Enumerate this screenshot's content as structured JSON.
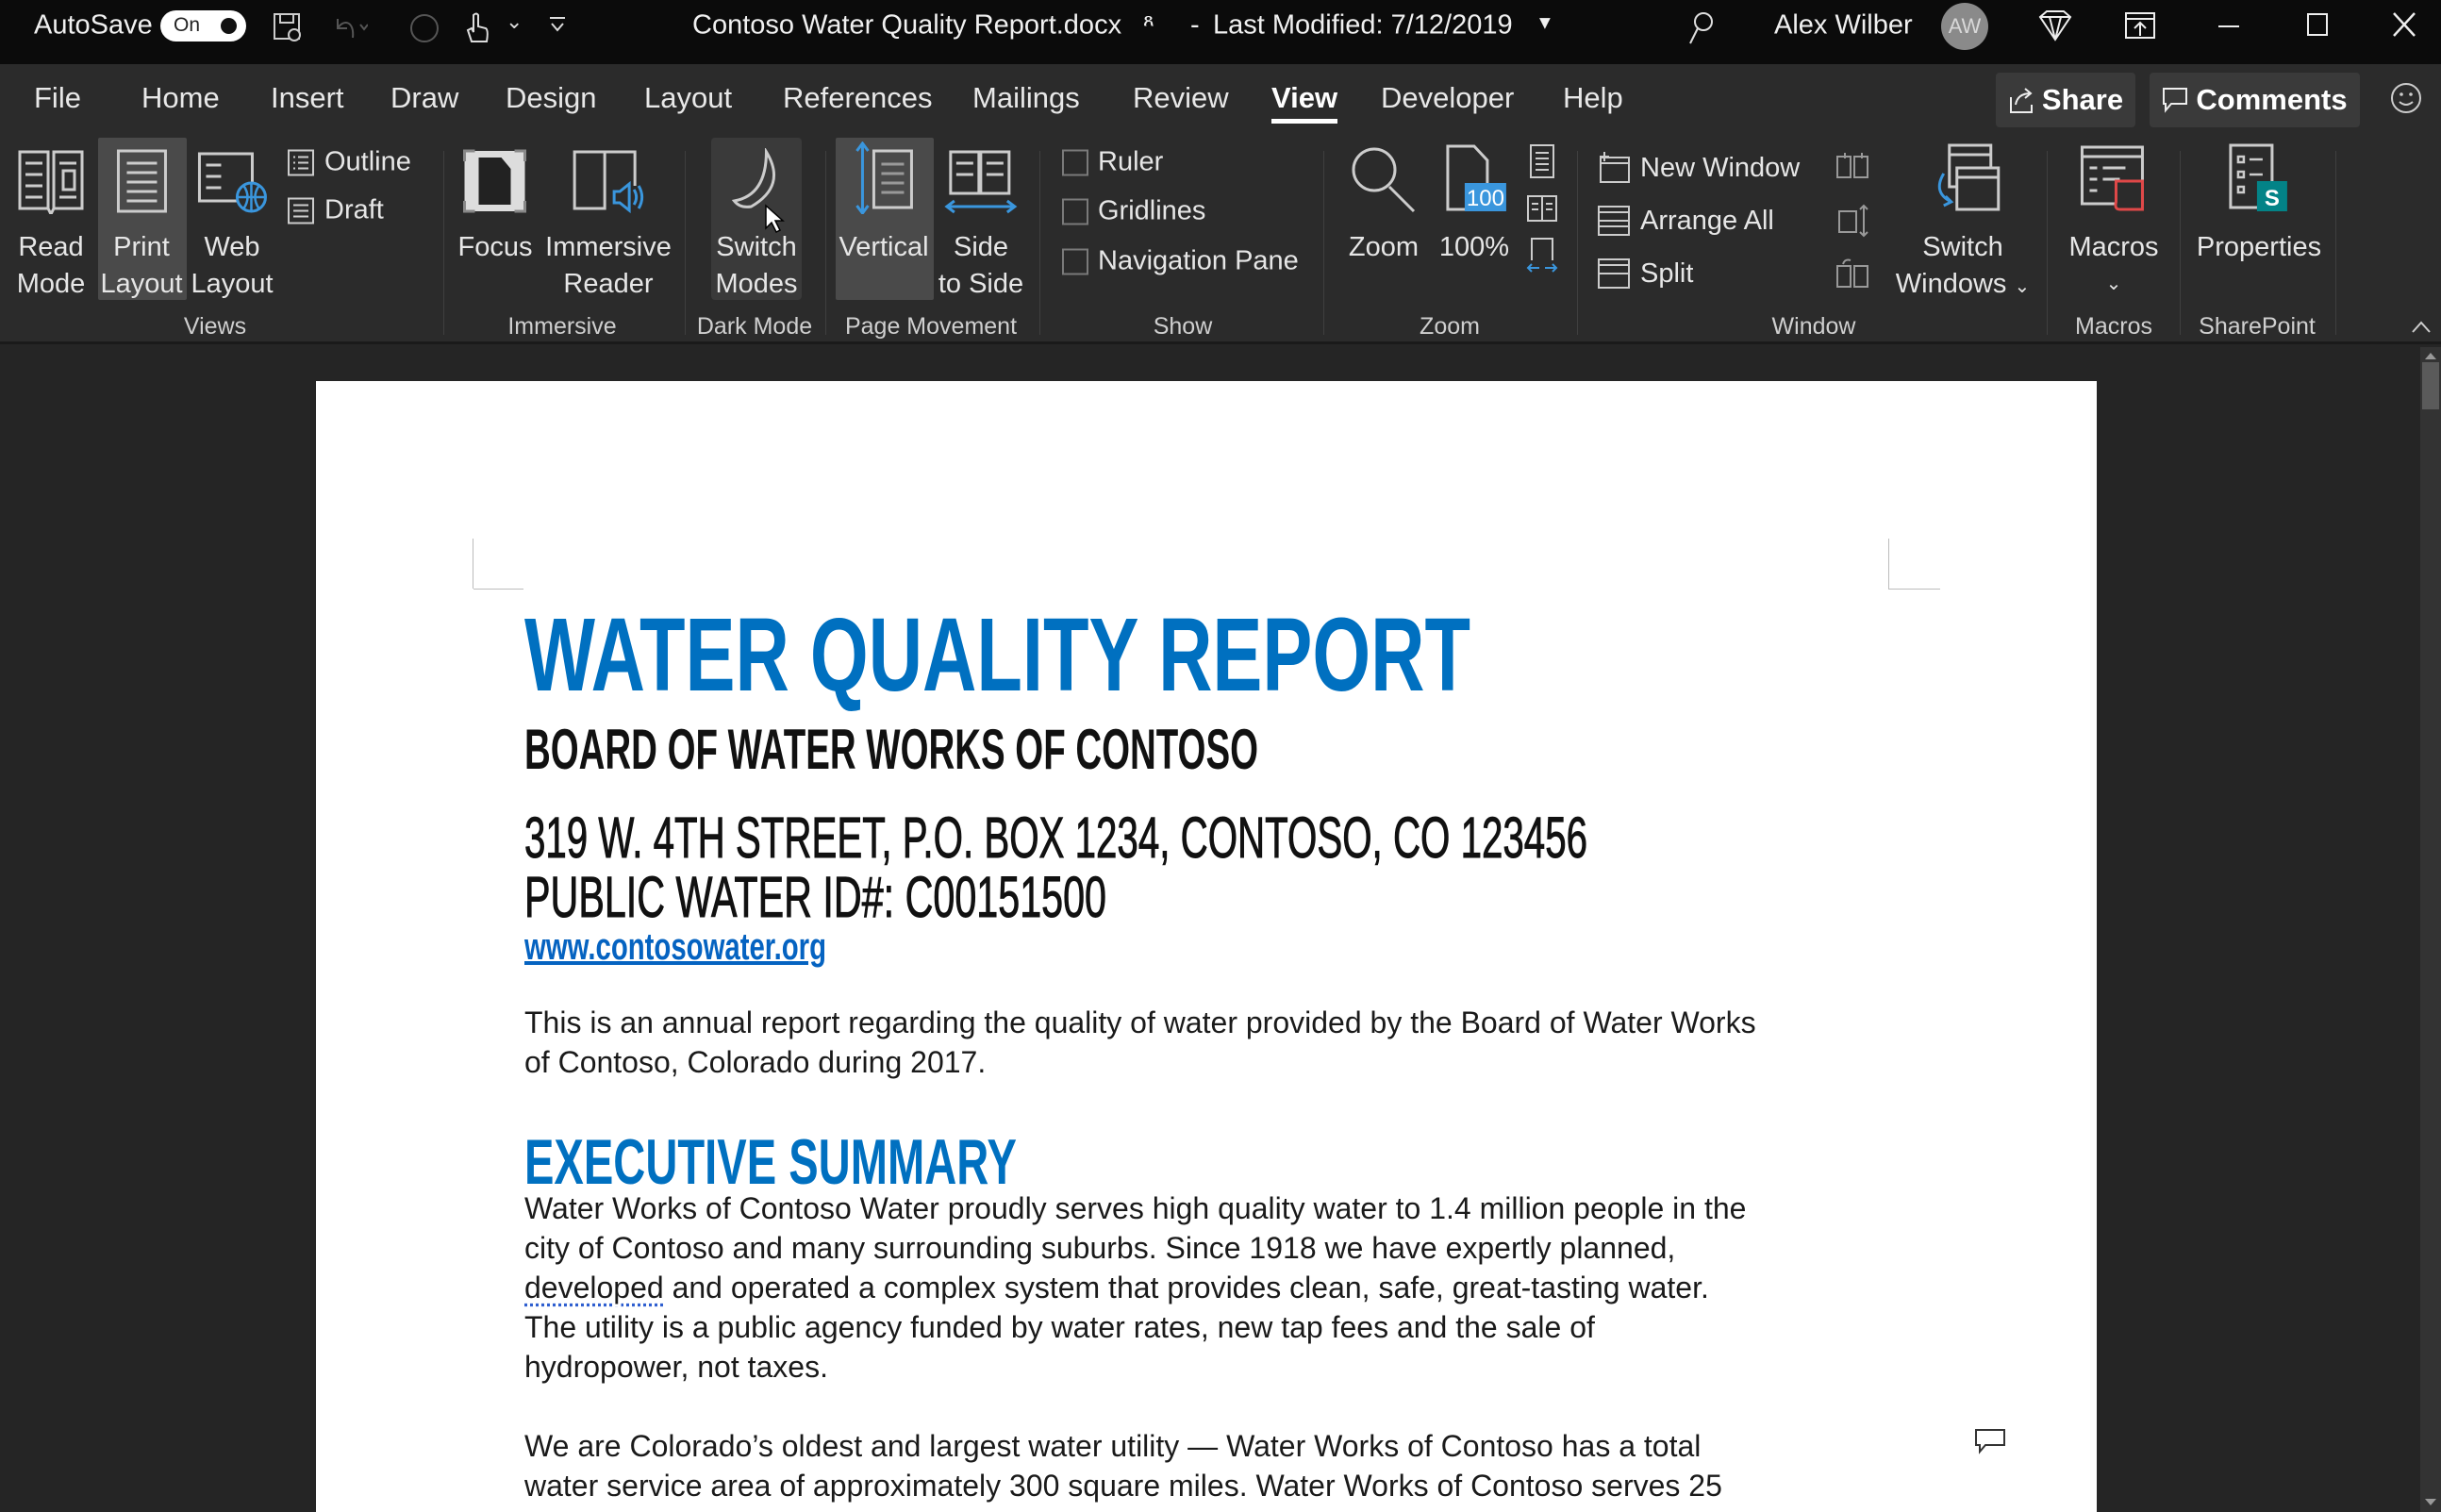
{
  "titlebar": {
    "autosave_label": "AutoSave",
    "autosave_state": "On",
    "doc_title": "Contoso Water Quality Report.docx",
    "separator": "-",
    "last_modified": "Last Modified: 7/12/2019",
    "user_name": "Alex Wilber",
    "avatar_initials": "AW"
  },
  "tabs": [
    {
      "label": "File"
    },
    {
      "label": "Home"
    },
    {
      "label": "Insert"
    },
    {
      "label": "Draw"
    },
    {
      "label": "Design"
    },
    {
      "label": "Layout"
    },
    {
      "label": "References"
    },
    {
      "label": "Mailings"
    },
    {
      "label": "Review"
    },
    {
      "label": "View",
      "active": true
    },
    {
      "label": "Developer"
    },
    {
      "label": "Help"
    }
  ],
  "actions": {
    "share": "Share",
    "comments": "Comments"
  },
  "ribbon": {
    "views": {
      "read_mode": [
        "Read",
        "Mode"
      ],
      "print_layout": [
        "Print",
        "Layout"
      ],
      "web_layout": [
        "Web",
        "Layout"
      ],
      "outline": "Outline",
      "draft": "Draft",
      "group": "Views"
    },
    "immersive": {
      "focus": "Focus",
      "reader": [
        "Immersive",
        "Reader"
      ],
      "group": "Immersive"
    },
    "dark_mode": {
      "switch": [
        "Switch",
        "Modes"
      ],
      "group": "Dark Mode"
    },
    "page_movement": {
      "vertical": "Vertical",
      "side": [
        "Side",
        "to Side"
      ],
      "group": "Page Movement"
    },
    "show": {
      "ruler": "Ruler",
      "gridlines": "Gridlines",
      "nav_pane": "Navigation Pane",
      "group": "Show"
    },
    "zoom": {
      "zoom": "Zoom",
      "hundred": "100%",
      "badge": "100",
      "group": "Zoom"
    },
    "window": {
      "new_window": "New Window",
      "arrange_all": "Arrange All",
      "split": "Split",
      "switch": [
        "Switch",
        "Windows"
      ],
      "group": "Window"
    },
    "macros": {
      "macros": "Macros",
      "group": "Macros"
    },
    "sharepoint": {
      "properties": "Properties",
      "group": "SharePoint"
    }
  },
  "document": {
    "title": "WATER QUALITY REPORT",
    "org": "BOARD OF WATER WORKS OF CONTOSO",
    "address": "319 W. 4TH STREET, P.O. BOX 1234, CONTOSO, CO 123456",
    "water_id": "PUBLIC WATER ID#: C00151500",
    "url": "www.contosowater.org",
    "intro_lines": [
      "This is an annual report regarding the quality of water provided by the Board of Water Works",
      "of Contoso, Colorado during 2017."
    ],
    "exec_heading": "EXECUTIVE SUMMARY",
    "exec_lines": [
      "Water Works of Contoso Water proudly serves high quality water to 1.4 million people in the",
      "city of Contoso and many surrounding suburbs. Since 1918 we have expertly planned,",
      "",
      "The utility is a public agency funded by water rates, new tap fees and the sale of",
      "hydropower, not taxes."
    ],
    "exec_line3_flagged": "developed",
    "exec_line3_rest": " and operated a complex system that provides clean, safe, great-tasting water.",
    "para3_lines": [
      "We are Colorado’s oldest and largest water utility — Water Works of Contoso has a total",
      "water service area of approximately 300 square miles. Water Works of Contoso serves 25"
    ]
  },
  "colors": {
    "accent": "#0070c0",
    "titlebar": "#0b0b0b",
    "ribbon": "#2b2b2b",
    "canvas": "#252525",
    "icon_blue": "#3a96dd"
  }
}
